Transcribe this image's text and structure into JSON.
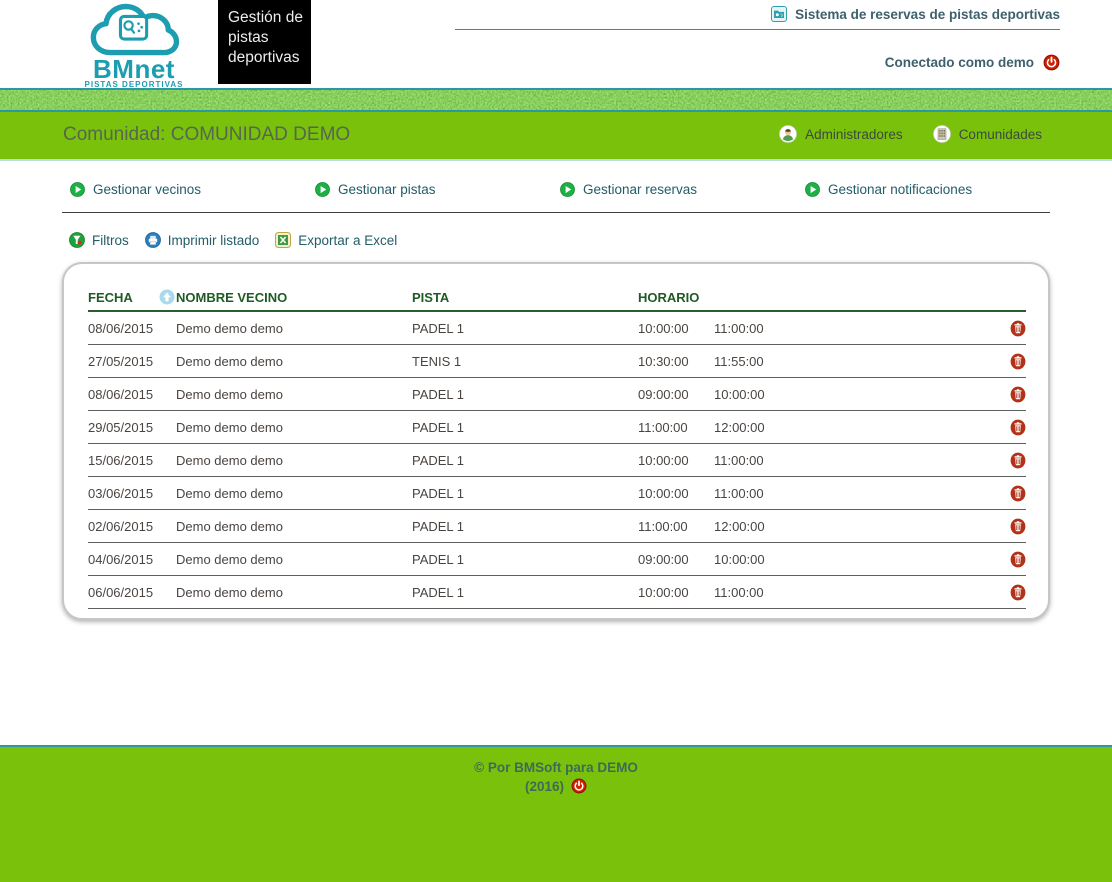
{
  "header": {
    "logo_name": "BMnet",
    "logo_sub": "PISTAS DEPORTIVAS",
    "black_box_text": "Gestión de pistas deportivas",
    "system_title": "Sistema de reservas de pistas deportivas",
    "connected_text": "Conectado como demo"
  },
  "community_bar": {
    "title": "Comunidad: COMUNIDAD DEMO",
    "links": [
      {
        "label": "Administradores"
      },
      {
        "label": "Comunidades"
      }
    ]
  },
  "menu": {
    "items": [
      {
        "label": "Gestionar vecinos"
      },
      {
        "label": "Gestionar pistas"
      },
      {
        "label": "Gestionar reservas"
      },
      {
        "label": "Gestionar notificaciones"
      }
    ]
  },
  "actions": {
    "items": [
      {
        "label": "Filtros"
      },
      {
        "label": "Imprimir listado"
      },
      {
        "label": "Exportar a Excel"
      }
    ]
  },
  "table": {
    "columns": [
      "FECHA",
      "NOMBRE VECINO",
      "PISTA",
      "HORARIO"
    ],
    "rows": [
      {
        "fecha": "08/06/2015",
        "nombre": "Demo demo demo",
        "pista": "PADEL 1",
        "inicio": "10:00:00",
        "fin": "11:00:00"
      },
      {
        "fecha": "27/05/2015",
        "nombre": "Demo demo demo",
        "pista": "TENIS 1",
        "inicio": "10:30:00",
        "fin": "11:55:00"
      },
      {
        "fecha": "08/06/2015",
        "nombre": "Demo demo demo",
        "pista": "PADEL 1",
        "inicio": "09:00:00",
        "fin": "10:00:00"
      },
      {
        "fecha": "29/05/2015",
        "nombre": "Demo demo demo",
        "pista": "PADEL 1",
        "inicio": "11:00:00",
        "fin": "12:00:00"
      },
      {
        "fecha": "15/06/2015",
        "nombre": "Demo demo demo",
        "pista": "PADEL 1",
        "inicio": "10:00:00",
        "fin": "11:00:00"
      },
      {
        "fecha": "03/06/2015",
        "nombre": "Demo demo demo",
        "pista": "PADEL 1",
        "inicio": "10:00:00",
        "fin": "11:00:00"
      },
      {
        "fecha": "02/06/2015",
        "nombre": "Demo demo demo",
        "pista": "PADEL 1",
        "inicio": "11:00:00",
        "fin": "12:00:00"
      },
      {
        "fecha": "04/06/2015",
        "nombre": "Demo demo demo",
        "pista": "PADEL 1",
        "inicio": "09:00:00",
        "fin": "10:00:00"
      },
      {
        "fecha": "06/06/2015",
        "nombre": "Demo demo demo",
        "pista": "PADEL 1",
        "inicio": "10:00:00",
        "fin": "11:00:00"
      }
    ]
  },
  "footer": {
    "line1": "© Por BMSoft para DEMO",
    "line2": "(2016)"
  },
  "icons": {
    "folder-icon": "teal folder badge",
    "power-icon": "red logout power button",
    "play-icon": "green circle with white play triangle",
    "filter-icon": "green circle filter",
    "printer-icon": "blue circle printer",
    "excel-icon": "excel export square",
    "sort-up-icon": "light blue circle up arrow",
    "person-icon": "administrator avatar",
    "building-icon": "community building",
    "trash-icon": "red delete trash can"
  },
  "colors": {
    "brand_teal": "#1d9db0",
    "line_teal": "#2d98a5",
    "green": "#7ac10c",
    "header_text": "#3e606c",
    "menu_text": "#235d68",
    "table_header_green": "#1e5b24",
    "delete_red": "#b23119",
    "power_red": "#d21f00"
  }
}
